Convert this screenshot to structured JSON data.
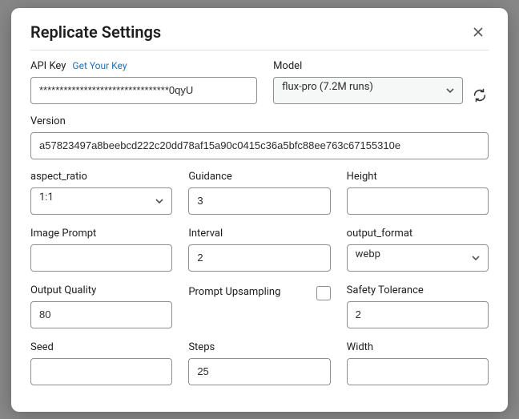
{
  "modal": {
    "title": "Replicate Settings",
    "api_key": {
      "label": "API Key",
      "link_text": "Get Your Key",
      "value": "********************************0qyU"
    },
    "model": {
      "label": "Model",
      "selected": "flux-pro (7.2M runs)"
    },
    "version": {
      "label": "Version",
      "value": "a57823497a8beebcd222c20dd78af15a90c0415c36a5bfc88ee763c67155310e"
    },
    "fields": {
      "aspect_ratio": {
        "label": "aspect_ratio",
        "value": "1:1"
      },
      "guidance": {
        "label": "Guidance",
        "value": "3"
      },
      "height": {
        "label": "Height",
        "value": ""
      },
      "image_prompt": {
        "label": "Image Prompt",
        "value": ""
      },
      "interval": {
        "label": "Interval",
        "value": "2"
      },
      "output_format": {
        "label": "output_format",
        "value": "webp"
      },
      "output_quality": {
        "label": "Output Quality",
        "value": "80"
      },
      "prompt_upsampling": {
        "label": "Prompt Upsampling"
      },
      "safety_tolerance": {
        "label": "Safety Tolerance",
        "value": "2"
      },
      "seed": {
        "label": "Seed",
        "value": ""
      },
      "steps": {
        "label": "Steps",
        "value": "25"
      },
      "width": {
        "label": "Width",
        "value": ""
      }
    }
  }
}
